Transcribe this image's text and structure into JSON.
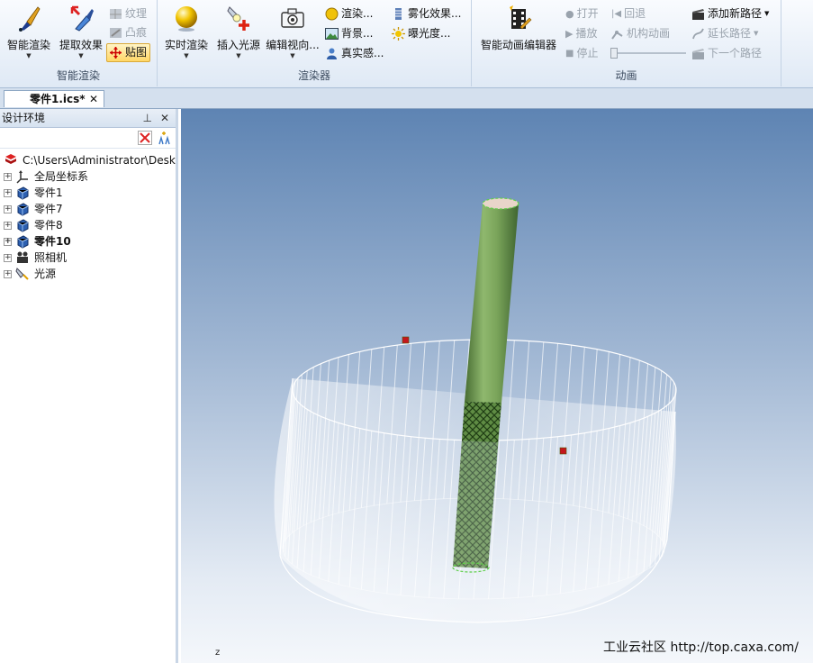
{
  "ribbon": {
    "groups": {
      "smart_render": "智能渲染",
      "renderer": "渲染器",
      "animation": "动画"
    },
    "buttons": {
      "smart_render": "智能渲染",
      "extract_effect": "提取效果",
      "texture": "纹理",
      "bump": "凸痕",
      "decal": "贴图",
      "realtime_render": "实时渲染",
      "insert_light": "插入光源",
      "edit_view": "编辑视向...",
      "render_dots": "渲染...",
      "background": "背景...",
      "realism": "真实感...",
      "fog_effect": "雾化效果...",
      "exposure": "曝光度...",
      "smart_anim_editor": "智能动画编辑器",
      "open": "打开",
      "rewind": "回退",
      "play": "播放",
      "mechanism_anim": "机构动画",
      "stop": "停止",
      "add_path": "添加新路径",
      "extend_path": "延长路径",
      "next_path": "下一个路径"
    }
  },
  "doc_tab": {
    "label": "零件1.ics*",
    "close": "✕"
  },
  "panel": {
    "title": "设计环境",
    "pin": "ᵖ",
    "close": "✕",
    "tree": [
      {
        "label": "C:\\Users\\Administrator\\Desk",
        "bold": false
      },
      {
        "label": "全局坐标系",
        "bold": false
      },
      {
        "label": "零件1",
        "bold": false
      },
      {
        "label": "零件7",
        "bold": false
      },
      {
        "label": "零件8",
        "bold": false
      },
      {
        "label": "零件10",
        "bold": true
      },
      {
        "label": "照相机",
        "bold": false
      },
      {
        "label": "光源",
        "bold": false
      }
    ]
  },
  "viewport": {
    "axis_label": "z",
    "watermark": "工业云社区 http://top.caxa.com/"
  }
}
